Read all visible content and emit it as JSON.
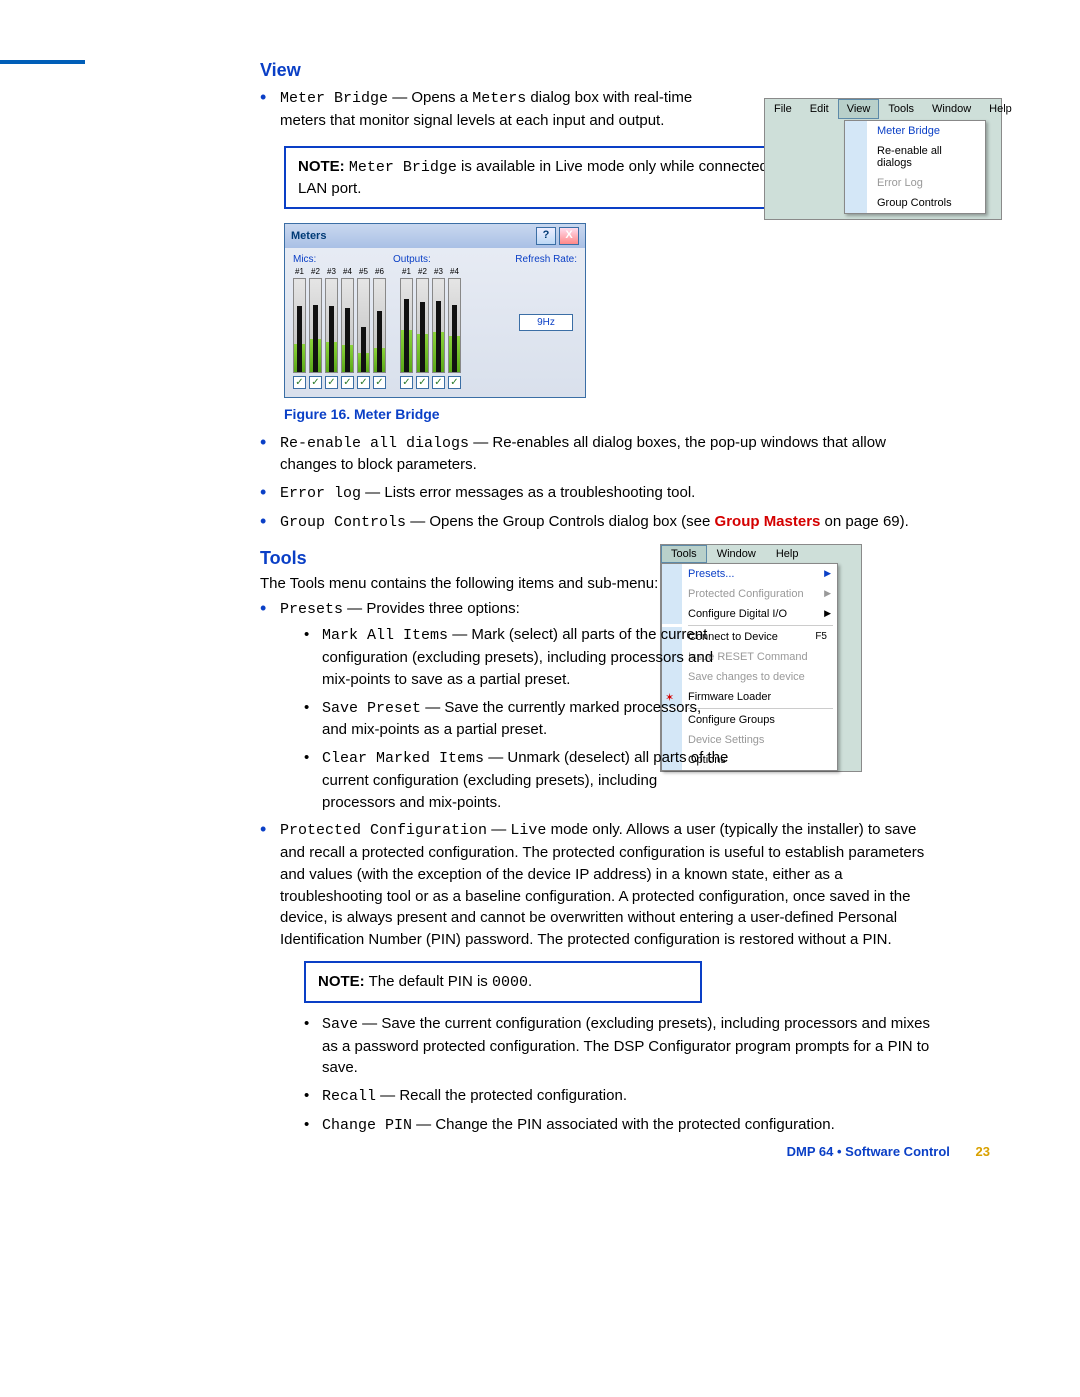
{
  "sections": {
    "view": {
      "heading": "View",
      "items": {
        "meterBridge": {
          "term": "Meter Bridge",
          "desc1": " — Opens a ",
          "codeword": "Meters",
          "desc2": " dialog box with real-time meters that monitor signal levels at each input and output."
        },
        "reenable": {
          "term": "Re-enable all dialogs",
          "desc": " — Re-enables all dialog boxes, the pop-up windows that allow changes to block parameters."
        },
        "errorlog": {
          "term": "Error log",
          "desc": " — Lists error messages as a troubleshooting tool."
        },
        "groupControls": {
          "term": "Group Controls",
          "desc1": " — Opens the Group Controls dialog box (see ",
          "link": "Group Masters",
          "desc2": " on page 69)."
        }
      },
      "note": {
        "label": "NOTE:",
        "t1": "Meter Bridge",
        "t2": " is available in Live mode only while connected using the LAN port."
      },
      "figcaption": "Figure 16. Meter Bridge"
    },
    "tools": {
      "heading": "Tools",
      "intro": "The Tools menu contains the following items and sub-menu:",
      "presets": {
        "term": "Presets",
        "desc": " — Provides three options:",
        "sub": {
          "mark": {
            "term": "Mark All Items",
            "desc": " — Mark (select) all parts of the current configuration (excluding presets), including processors and mix-points to save as a partial preset."
          },
          "save": {
            "term": "Save Preset",
            "desc": " — Save the currently marked processors, and mix-points as a partial preset."
          },
          "clear": {
            "term": "Clear Marked Items",
            "desc": " — Unmark (deselect) all parts of the current configuration (excluding presets), including processors and mix-points."
          }
        }
      },
      "protected": {
        "term": "Protected Configuration",
        "desc1": " — ",
        "live": "Live",
        "desc2": " mode only. Allows a user (typically the installer) to save and recall a protected configuration. The protected configuration is useful to establish parameters and values (with the exception of the device IP address) in a known state, either as a troubleshooting tool or as a baseline configuration. A protected configuration, once saved in the device, is always present and cannot be overwritten without entering a user-defined Personal Identification Number (PIN) password. The protected configuration is restored without a PIN."
      },
      "note2": {
        "label": "NOTE:",
        "t1": " The default PIN is ",
        "pin": "0000",
        "t2": "."
      },
      "savei": {
        "term": "Save",
        "desc": " — Save the current configuration (excluding presets), including processors and mixes as a password protected configuration. The DSP Configurator program prompts for a PIN to save."
      },
      "recall": {
        "term": "Recall",
        "desc": " — Recall the protected configuration."
      },
      "changepin": {
        "term": "Change PIN",
        "desc": " — Change the PIN associated with the protected configuration."
      }
    }
  },
  "viewMenu": {
    "bar": [
      "File",
      "Edit",
      "View",
      "Tools",
      "Window",
      "Help"
    ],
    "items": [
      "Meter Bridge",
      "Re-enable all dialogs",
      "Error Log",
      "Group Controls"
    ]
  },
  "toolsMenu": {
    "bar": [
      "Tools",
      "Window",
      "Help"
    ],
    "items": [
      {
        "t": "Presets...",
        "arrow": true,
        "sel": true
      },
      {
        "t": "Protected Configuration",
        "arrow": true,
        "disabled": true
      },
      {
        "t": "Configure Digital I/O",
        "arrow": true
      },
      {
        "hr": true
      },
      {
        "t": "Connect to Device",
        "shortcut": "F5"
      },
      {
        "t": "Issue RESET Command",
        "disabled": true
      },
      {
        "t": "Save changes to device",
        "disabled": true
      },
      {
        "t": "Firmware Loader",
        "star": true
      },
      {
        "hr": true
      },
      {
        "t": "Configure Groups"
      },
      {
        "t": "Device Settings",
        "disabled": true
      },
      {
        "t": "Options"
      }
    ]
  },
  "metersDialog": {
    "title": "Meters",
    "micsLabel": "Mics:",
    "outputsLabel": "Outputs:",
    "refreshLabel": "Refresh Rate:",
    "refreshValue": "9Hz",
    "micTicks": [
      "#1",
      "#2",
      "#3",
      "#4",
      "#5",
      "#6"
    ],
    "outTicks": [
      "#1",
      "#2",
      "#3",
      "#4"
    ],
    "micFills": [
      30,
      35,
      32,
      28,
      20,
      25
    ],
    "micBars": [
      70,
      72,
      70,
      68,
      48,
      65
    ],
    "outFills": [
      45,
      40,
      42,
      38
    ],
    "outBars": [
      78,
      75,
      76,
      72
    ]
  },
  "footer": {
    "txt": "DMP 64 • Software Control",
    "pg": "23"
  }
}
